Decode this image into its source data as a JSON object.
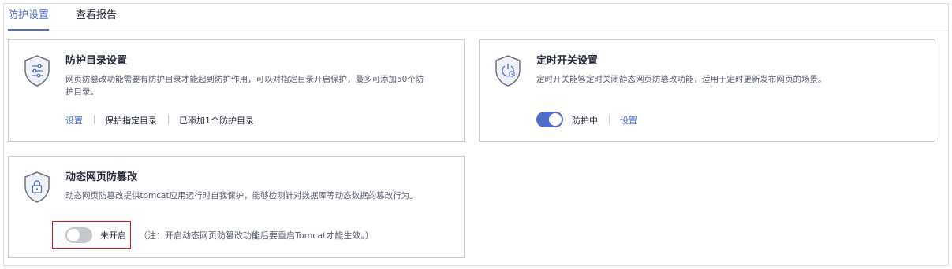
{
  "tabs": [
    {
      "label": "防护设置",
      "active": true
    },
    {
      "label": "查看报告",
      "active": false
    }
  ],
  "colors": {
    "accent": "#526ecc",
    "highlight_border": "#d0161f",
    "toggle_off": "#c5c8cf"
  },
  "cards": {
    "directory": {
      "icon": "shield-sliders-icon",
      "title": "防护目录设置",
      "desc_line1": "网页防篡改功能需要有防护目录才能起到防护作用，可以对指定目录开启保护，最多可添加50个防",
      "desc_line2": "护目录。",
      "links": {
        "settings": "设置",
        "protect_dir": "保护指定目录",
        "added": "已添加1个防护目录"
      }
    },
    "timer": {
      "icon": "shield-clock-icon",
      "title": "定时开关设置",
      "desc": "定时开关能够定时关闭静态网页防篡改功能，适用于定时更新发布网页的场景。",
      "toggle_on": true,
      "status": "防护中",
      "settings": "设置"
    },
    "dynamic": {
      "icon": "shield-lock-icon",
      "title": "动态网页防篡改",
      "desc": "动态网页防篡改提供tomcat应用运行时自我保护，能够检测针对数据库等动态数据的篡改行为。",
      "toggle_on": false,
      "status": "未开启",
      "note": "（注：开启动态网页防篡改功能后要重启Tomcat才能生效。）"
    }
  }
}
